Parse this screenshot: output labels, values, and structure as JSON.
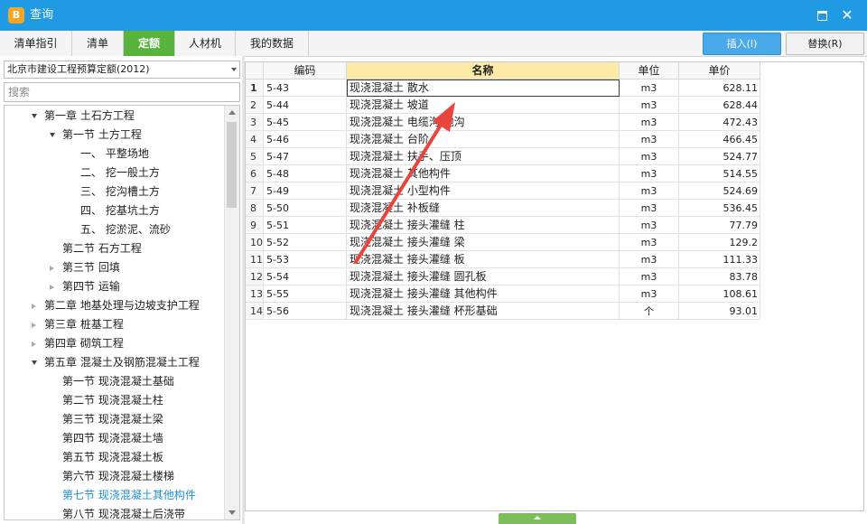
{
  "window": {
    "title": "查询",
    "app_icon": "app-logo-icon",
    "maximize_icon": "maximize-icon",
    "close_icon": "close-icon",
    "close_glyph": "✕",
    "title_color": "#1f9ae3"
  },
  "tabs": [
    {
      "label": "清单指引",
      "active": false
    },
    {
      "label": "清单",
      "active": false
    },
    {
      "label": "定额",
      "active": true
    },
    {
      "label": "人材机",
      "active": false
    },
    {
      "label": "我的数据",
      "active": false
    }
  ],
  "actions": {
    "insert_label": "插入(I)",
    "replace_label": "替换(R)"
  },
  "left_panel": {
    "quota_library": "北京市建设工程预算定额(2012)",
    "search_placeholder": "搜索",
    "tree": [
      {
        "label": "第一章 土石方工程",
        "level": 1,
        "toggle": "open"
      },
      {
        "label": "第一节 土方工程",
        "level": 2,
        "toggle": "open"
      },
      {
        "label": "一、 平整场地",
        "level": 3,
        "toggle": "none"
      },
      {
        "label": "二、 挖一般土方",
        "level": 3,
        "toggle": "none"
      },
      {
        "label": "三、 挖沟槽土方",
        "level": 3,
        "toggle": "none"
      },
      {
        "label": "四、 挖基坑土方",
        "level": 3,
        "toggle": "none"
      },
      {
        "label": "五、 挖淤泥、流砂",
        "level": 3,
        "toggle": "none"
      },
      {
        "label": "第二节 石方工程",
        "level": 2,
        "toggle": "none"
      },
      {
        "label": "第三节 回填",
        "level": 2,
        "toggle": "closed"
      },
      {
        "label": "第四节 运输",
        "level": 2,
        "toggle": "closed"
      },
      {
        "label": "第二章 地基处理与边坡支护工程",
        "level": 1,
        "toggle": "closed"
      },
      {
        "label": "第三章 桩基工程",
        "level": 1,
        "toggle": "closed"
      },
      {
        "label": "第四章 砌筑工程",
        "level": 1,
        "toggle": "closed"
      },
      {
        "label": "第五章 混凝土及钢筋混凝土工程",
        "level": 1,
        "toggle": "open"
      },
      {
        "label": "第一节 现浇混凝土基础",
        "level": 2,
        "toggle": "none"
      },
      {
        "label": "第二节 现浇混凝土柱",
        "level": 2,
        "toggle": "none"
      },
      {
        "label": "第三节 现浇混凝土梁",
        "level": 2,
        "toggle": "none"
      },
      {
        "label": "第四节 现浇混凝土墙",
        "level": 2,
        "toggle": "none"
      },
      {
        "label": "第五节 现浇混凝土板",
        "level": 2,
        "toggle": "none"
      },
      {
        "label": "第六节 现浇混凝土楼梯",
        "level": 2,
        "toggle": "none"
      },
      {
        "label": "第七节 现浇混凝土其他构件",
        "level": 2,
        "toggle": "none",
        "selected": true
      },
      {
        "label": "第八节 现浇混凝土后浇带",
        "level": 2,
        "toggle": "none"
      }
    ]
  },
  "grid": {
    "columns": [
      "编码",
      "名称",
      "单位",
      "单价"
    ],
    "rows": [
      {
        "idx": "1",
        "code": "5-43",
        "name": "现浇混凝土 散水",
        "unit": "m3",
        "price": "628.11"
      },
      {
        "idx": "2",
        "code": "5-44",
        "name": "现浇混凝土 坡道",
        "unit": "m3",
        "price": "628.44"
      },
      {
        "idx": "3",
        "code": "5-45",
        "name": "现浇混凝土 电缆沟 地沟",
        "unit": "m3",
        "price": "472.43"
      },
      {
        "idx": "4",
        "code": "5-46",
        "name": "现浇混凝土 台阶",
        "unit": "m3",
        "price": "466.45"
      },
      {
        "idx": "5",
        "code": "5-47",
        "name": "现浇混凝土 扶手、压顶",
        "unit": "m3",
        "price": "524.77"
      },
      {
        "idx": "6",
        "code": "5-48",
        "name": "现浇混凝土 其他构件",
        "unit": "m3",
        "price": "514.55"
      },
      {
        "idx": "7",
        "code": "5-49",
        "name": "现浇混凝土 小型构件",
        "unit": "m3",
        "price": "524.69"
      },
      {
        "idx": "8",
        "code": "5-50",
        "name": "现浇混凝土 补板缝",
        "unit": "m3",
        "price": "536.45"
      },
      {
        "idx": "9",
        "code": "5-51",
        "name": "现浇混凝土 接头灌缝 柱",
        "unit": "m3",
        "price": "77.79"
      },
      {
        "idx": "10",
        "code": "5-52",
        "name": "现浇混凝土 接头灌缝 梁",
        "unit": "m3",
        "price": "129.2"
      },
      {
        "idx": "11",
        "code": "5-53",
        "name": "现浇混凝土 接头灌缝 板",
        "unit": "m3",
        "price": "111.33"
      },
      {
        "idx": "12",
        "code": "5-54",
        "name": "现浇混凝土 接头灌缝 圆孔板",
        "unit": "m3",
        "price": "83.78"
      },
      {
        "idx": "13",
        "code": "5-55",
        "name": "现浇混凝土 接头灌缝 其他构件",
        "unit": "m3",
        "price": "108.61"
      },
      {
        "idx": "14",
        "code": "5-56",
        "name": "现浇混凝土 接头灌缝 杯形基础",
        "unit": "个",
        "price": "93.01"
      }
    ],
    "selected_row": 0
  },
  "annotation": {
    "icon": "red-arrow-icon",
    "color": "#e8453c"
  },
  "colors": {
    "accent_green": "#58b33d",
    "insert_blue": "#4aa9e8",
    "header_highlight": "#fdeaa6",
    "selected_tree": "#1e8fd6"
  }
}
